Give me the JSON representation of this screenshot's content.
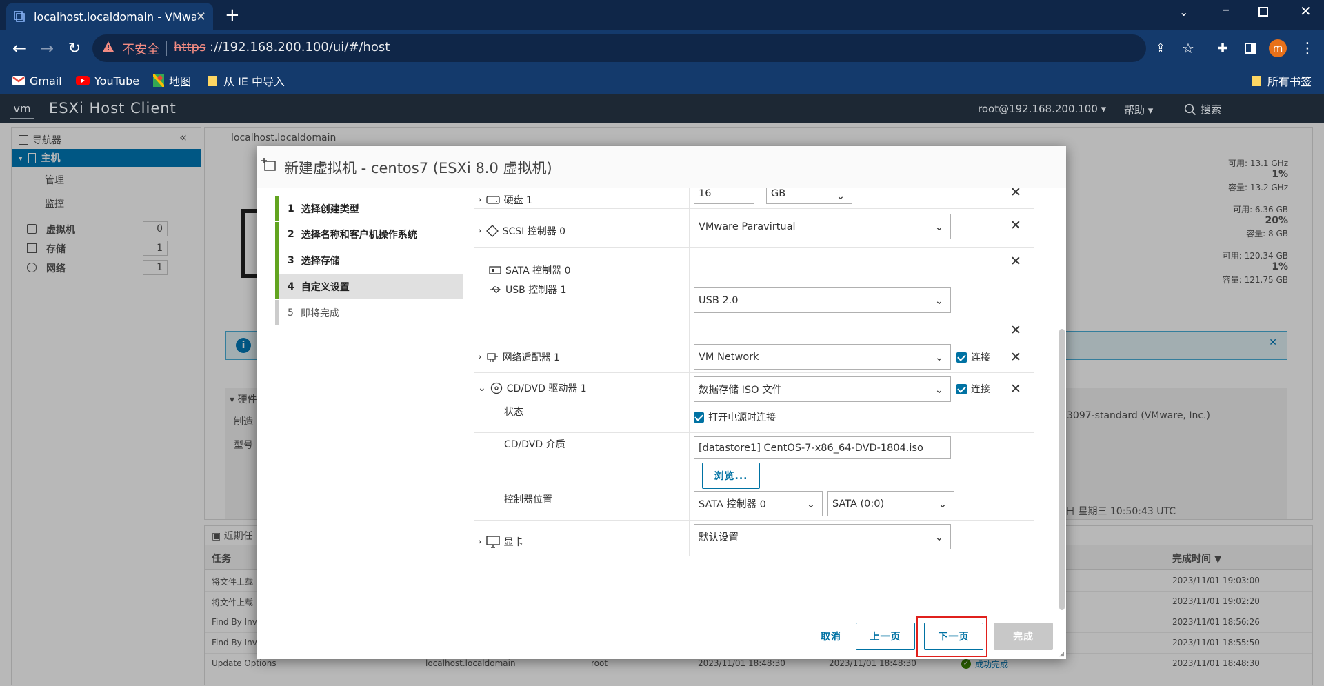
{
  "browser": {
    "tab_title": "localhost.localdomain - VMware",
    "insecure_label": "不安全",
    "url_scheme": "https",
    "url_rest": "://192.168.200.100/ui/#/host",
    "bookmarks": [
      "Gmail",
      "YouTube",
      "地图",
      "从 IE 中导入"
    ],
    "all_bookmarks": "所有书签",
    "profile_initial": "m"
  },
  "esxi": {
    "logo": "vm",
    "product": "ESXi Host Client",
    "user": "root@192.168.200.100",
    "help": "帮助",
    "search": "搜索"
  },
  "navigator": {
    "title": "导航器",
    "host": "主机",
    "host_children": [
      "管理",
      "监控"
    ],
    "items": [
      {
        "label": "虚拟机",
        "count": "0"
      },
      {
        "label": "存储",
        "count": "1"
      },
      {
        "label": "网络",
        "count": "1"
      }
    ]
  },
  "host_panel": {
    "title": "localhost.localdomain",
    "cpu_free": "可用: 13.1 GHz",
    "cpu_pct": "1%",
    "cpu_cap": "容量: 13.2 GHz",
    "mem_free": "可用: 6.36 GB",
    "mem_pct": "20%",
    "mem_cap": "容量: 8 GB",
    "sto_free": "可用: 120.34 GB",
    "sto_pct": "1%",
    "sto_cap": "容量: 121.75 GB",
    "hardware": "硬件",
    "hw_rows": [
      "制造",
      "型号"
    ],
    "bios": "3097-standard (VMware, Inc.)",
    "partial_ghz": "z",
    "partial_b": "B",
    "boot_time": "日 星期三 10:50:43 UTC"
  },
  "recent_tasks": {
    "title": "近期任",
    "col_task": "任务",
    "col_done": "完成时间 ▼",
    "rows": [
      {
        "task": "将文件上载",
        "done": "2023/11/01 19:03:00"
      },
      {
        "task": "将文件上载",
        "done": "2023/11/01 19:02:20"
      },
      {
        "task": "Find By Inv",
        "done": "2023/11/01 18:56:26"
      },
      {
        "task": "Find By Inv",
        "done": "2023/11/01 18:55:50"
      },
      {
        "task": "Update Options",
        "target": "localhost.localdomain",
        "initiator": "root",
        "queued": "2023/11/01 18:48:30",
        "started": "2023/11/01 18:48:30",
        "result": "成功完成",
        "done": "2023/11/01 18:48:30"
      }
    ]
  },
  "modal": {
    "title": "新建虚拟机 - centos7 (ESXi 8.0 虚拟机)",
    "steps": [
      {
        "num": "1",
        "label": "选择创建类型"
      },
      {
        "num": "2",
        "label": "选择名称和客户机操作系统"
      },
      {
        "num": "3",
        "label": "选择存储"
      },
      {
        "num": "4",
        "label": "自定义设置"
      },
      {
        "num": "5",
        "label": "即将完成"
      }
    ],
    "hw": {
      "disk_label": "硬盘 1",
      "disk_size": "16",
      "disk_unit": "GB",
      "scsi_label": "SCSI 控制器 0",
      "scsi_value": "VMware Paravirtual",
      "sata_label": "SATA 控制器 0",
      "usb_label": "USB 控制器 1",
      "usb_value": "USB 2.0",
      "net_label": "网络适配器 1",
      "net_value": "VM Network",
      "connect": "连接",
      "cd_label": "CD/DVD 驱动器 1",
      "cd_value": "数据存储 ISO 文件",
      "status_label": "状态",
      "status_check": "打开电源时连接",
      "media_label": "CD/DVD 介质",
      "media_value": "[datastore1] CentOS-7-x86_64-DVD-1804.iso",
      "browse": "浏览...",
      "ctrl_label": "控制器位置",
      "ctrl_value": "SATA 控制器 0",
      "ctrl_slot": "SATA (0:0)",
      "video_label": "显卡",
      "video_value": "默认设置"
    },
    "buttons": {
      "cancel": "取消",
      "prev": "上一页",
      "next": "下一页",
      "finish": "完成"
    },
    "accent": "#0072a3",
    "step_done_color": "#62a420",
    "highlight_color": "#e0201c"
  }
}
